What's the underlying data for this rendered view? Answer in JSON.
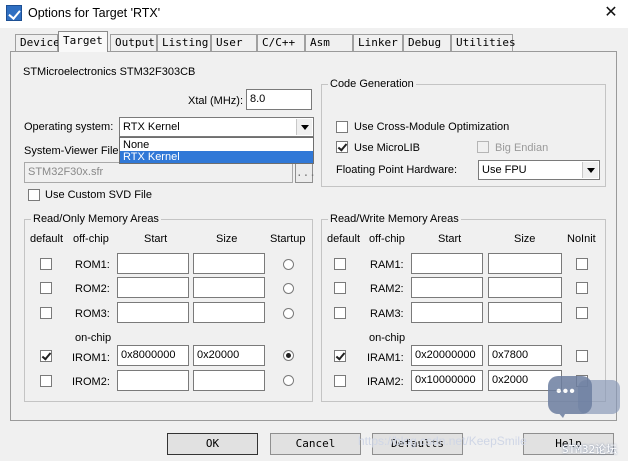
{
  "window": {
    "title": "Options for Target 'RTX'",
    "close_glyph": "✕"
  },
  "tabs": [
    {
      "label": "Device",
      "active": false
    },
    {
      "label": "Target",
      "active": true
    },
    {
      "label": "Output",
      "active": false
    },
    {
      "label": "Listing",
      "active": false
    },
    {
      "label": "User",
      "active": false
    },
    {
      "label": "C/C++",
      "active": false
    },
    {
      "label": "Asm",
      "active": false
    },
    {
      "label": "Linker",
      "active": false
    },
    {
      "label": "Debug",
      "active": false
    },
    {
      "label": "Utilities",
      "active": false
    }
  ],
  "device": {
    "name": "STMicroelectronics STM32F303CB"
  },
  "xtal": {
    "label": "Xtal (MHz):",
    "value": "8.0"
  },
  "os": {
    "label": "Operating system:",
    "selected": "RTX Kernel",
    "options": [
      "None",
      "RTX Kernel"
    ],
    "highlighted": "RTX Kernel"
  },
  "svd": {
    "label": "System-Viewer File (",
    "value": "STM32F30x.sfr",
    "browse": "...",
    "custom_label": "Use Custom SVD File",
    "custom_checked": false
  },
  "codegen": {
    "title": "Code Generation",
    "cross_module": {
      "label": "Use Cross-Module Optimization",
      "checked": false
    },
    "microlib": {
      "label": "Use MicroLIB",
      "checked": true
    },
    "big_endian": {
      "label": "Big Endian",
      "checked": false,
      "enabled": false
    },
    "fp_label": "Floating Point Hardware:",
    "fp_value": "Use FPU"
  },
  "ro_memory": {
    "title": "Read/Only Memory Areas",
    "headers": {
      "default": "default",
      "offchip": "off-chip",
      "start": "Start",
      "size": "Size",
      "last": "Startup"
    },
    "onchip_label": "on-chip",
    "rows": [
      {
        "name": "ROM1:",
        "default": false,
        "start": "",
        "size": "",
        "radio": false
      },
      {
        "name": "ROM2:",
        "default": false,
        "start": "",
        "size": "",
        "radio": false
      },
      {
        "name": "ROM3:",
        "default": false,
        "start": "",
        "size": "",
        "radio": false
      },
      {
        "name": "IROM1:",
        "default": true,
        "start": "0x8000000",
        "size": "0x20000",
        "radio": true
      },
      {
        "name": "IROM2:",
        "default": false,
        "start": "",
        "size": "",
        "radio": false
      }
    ]
  },
  "rw_memory": {
    "title": "Read/Write Memory Areas",
    "headers": {
      "default": "default",
      "offchip": "off-chip",
      "start": "Start",
      "size": "Size",
      "last": "NoInit"
    },
    "onchip_label": "on-chip",
    "rows": [
      {
        "name": "RAM1:",
        "default": false,
        "start": "",
        "size": "",
        "noinit": false
      },
      {
        "name": "RAM2:",
        "default": false,
        "start": "",
        "size": "",
        "noinit": false
      },
      {
        "name": "RAM3:",
        "default": false,
        "start": "",
        "size": "",
        "noinit": false
      },
      {
        "name": "IRAM1:",
        "default": true,
        "start": "0x20000000",
        "size": "0x7800",
        "noinit": false
      },
      {
        "name": "IRAM2:",
        "default": false,
        "start": "0x10000000",
        "size": "0x2000",
        "noinit": false
      }
    ]
  },
  "buttons": {
    "ok": "OK",
    "cancel": "Cancel",
    "defaults": "Defaults",
    "help": "Help"
  },
  "watermark": "https://blog.csdn.net/KeepSmile",
  "overlay_text": "STM32论坛"
}
